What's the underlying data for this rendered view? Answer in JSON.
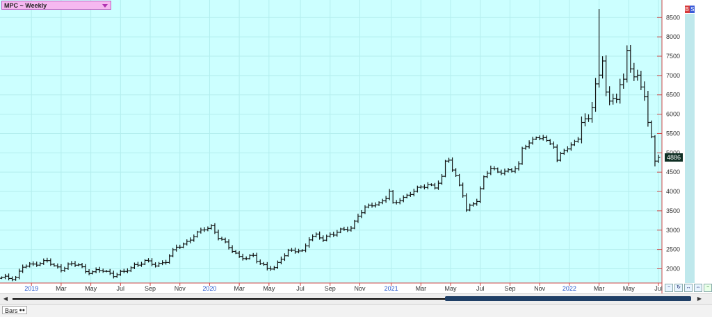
{
  "title_box": {
    "label": "MPC ~ Weekly"
  },
  "price_tag": {
    "label": "4886"
  },
  "corner_badge": {
    "label": "B S"
  },
  "bottom": {
    "chart_style_label": "Bars"
  },
  "nav_icons": [
    "zoom-out-icon",
    "refresh-icon",
    "zoom-in-icon",
    "fit-icon",
    "minus-icon",
    "plus-icon"
  ],
  "colors": {
    "plot_bg": "#ccffff",
    "grid": "#b3eeee",
    "bars": "#111111",
    "axis_line": "#cc4444",
    "axis_text": "#333333",
    "year_text": "#2255cc",
    "month_text": "#333333"
  },
  "chart_data": {
    "type": "bar",
    "title": "MPC ~ Weekly",
    "ylim": [
      1650,
      8900
    ],
    "yticks": [
      2000,
      2500,
      3000,
      3500,
      4000,
      4500,
      5000,
      5500,
      6000,
      6500,
      7000,
      7500,
      8000,
      8500
    ],
    "ytick_labels": [
      "2000",
      "2500",
      "3000",
      "3500",
      "4000",
      "4500",
      "5000",
      "5500",
      "6000",
      "6500",
      "7000",
      "7500",
      "8000",
      "8500"
    ],
    "x_range": [
      0,
      185
    ],
    "xticks": [
      {
        "x": 9,
        "label": "2019",
        "year": true
      },
      {
        "x": 17.5,
        "label": "Mar",
        "year": false
      },
      {
        "x": 26,
        "label": "May",
        "year": false
      },
      {
        "x": 34.5,
        "label": "Jul",
        "year": false
      },
      {
        "x": 43,
        "label": "Sep",
        "year": false
      },
      {
        "x": 51.5,
        "label": "Nov",
        "year": false
      },
      {
        "x": 60,
        "label": "2020",
        "year": true
      },
      {
        "x": 68.5,
        "label": "Mar",
        "year": false
      },
      {
        "x": 77,
        "label": "May",
        "year": false
      },
      {
        "x": 86,
        "label": "Jul",
        "year": false
      },
      {
        "x": 94.5,
        "label": "Sep",
        "year": false
      },
      {
        "x": 103,
        "label": "Nov",
        "year": false
      },
      {
        "x": 112,
        "label": "2021",
        "year": true
      },
      {
        "x": 120.5,
        "label": "Mar",
        "year": false
      },
      {
        "x": 129,
        "label": "May",
        "year": false
      },
      {
        "x": 137.5,
        "label": "Jul",
        "year": false
      },
      {
        "x": 146,
        "label": "Sep",
        "year": false
      },
      {
        "x": 154.5,
        "label": "Nov",
        "year": false
      },
      {
        "x": 163,
        "label": "2022",
        "year": true
      },
      {
        "x": 171.5,
        "label": "Mar",
        "year": false
      },
      {
        "x": 180,
        "label": "May",
        "year": false
      },
      {
        "x": 188.5,
        "label": "Jul",
        "year": false
      }
    ],
    "anchors": [
      [
        0,
        1750
      ],
      [
        4,
        1780
      ],
      [
        6,
        2050
      ],
      [
        8,
        2080
      ],
      [
        10,
        2150
      ],
      [
        13,
        2200
      ],
      [
        15,
        2050
      ],
      [
        17,
        2000
      ],
      [
        19,
        2100
      ],
      [
        22,
        2100
      ],
      [
        24,
        1950
      ],
      [
        26,
        1920
      ],
      [
        29,
        1950
      ],
      [
        32,
        1850
      ],
      [
        35,
        1900
      ],
      [
        38,
        2100
      ],
      [
        41,
        2180
      ],
      [
        44,
        2100
      ],
      [
        47,
        2200
      ],
      [
        50,
        2550
      ],
      [
        53,
        2700
      ],
      [
        56,
        2900
      ],
      [
        58,
        3050
      ],
      [
        60,
        3100
      ],
      [
        62,
        2800
      ],
      [
        64,
        2650
      ],
      [
        66,
        2500
      ],
      [
        68,
        2300
      ],
      [
        70,
        2250
      ],
      [
        72,
        2350
      ],
      [
        74,
        2150
      ],
      [
        76,
        2000
      ],
      [
        78,
        2000
      ],
      [
        80,
        2300
      ],
      [
        82,
        2450
      ],
      [
        84,
        2450
      ],
      [
        86,
        2450
      ],
      [
        88,
        2800
      ],
      [
        90,
        2850
      ],
      [
        92,
        2750
      ],
      [
        94,
        2900
      ],
      [
        96,
        2950
      ],
      [
        98,
        3000
      ],
      [
        100,
        3050
      ],
      [
        102,
        3400
      ],
      [
        104,
        3550
      ],
      [
        106,
        3650
      ],
      [
        108,
        3700
      ],
      [
        110,
        3850
      ],
      [
        111,
        3980
      ],
      [
        112,
        3650
      ],
      [
        114,
        3800
      ],
      [
        116,
        3900
      ],
      [
        118,
        4000
      ],
      [
        120,
        4100
      ],
      [
        122,
        4200
      ],
      [
        124,
        4100
      ],
      [
        126,
        4350
      ],
      [
        127,
        4750
      ],
      [
        128,
        4850
      ],
      [
        129,
        4600
      ],
      [
        130,
        4400
      ],
      [
        132,
        3900
      ],
      [
        133,
        3500
      ],
      [
        134,
        3600
      ],
      [
        136,
        3800
      ],
      [
        138,
        4350
      ],
      [
        140,
        4600
      ],
      [
        142,
        4500
      ],
      [
        144,
        4550
      ],
      [
        146,
        4500
      ],
      [
        148,
        4700
      ],
      [
        149,
        5100
      ],
      [
        151,
        5300
      ],
      [
        153,
        5350
      ],
      [
        155,
        5400
      ],
      [
        156,
        5300
      ],
      [
        158,
        5200
      ],
      [
        159,
        4800
      ],
      [
        161,
        5050
      ],
      [
        163,
        5200
      ],
      [
        165,
        5400
      ],
      [
        166,
        5800
      ],
      [
        168,
        5850
      ],
      [
        169,
        6200
      ],
      [
        170,
        6800
      ],
      [
        171,
        7000
      ],
      [
        172,
        7400
      ],
      [
        173,
        6600
      ],
      [
        174,
        6300
      ],
      [
        176,
        6400
      ],
      [
        177,
        6800
      ],
      [
        178,
        6900
      ],
      [
        179,
        7650
      ],
      [
        180,
        7200
      ],
      [
        181,
        6950
      ],
      [
        182,
        6950
      ],
      [
        183,
        6700
      ],
      [
        184,
        6500
      ],
      [
        185,
        5800
      ],
      [
        186,
        5400
      ],
      [
        187,
        4800
      ],
      [
        188,
        4886
      ]
    ],
    "last_value": 4886
  }
}
